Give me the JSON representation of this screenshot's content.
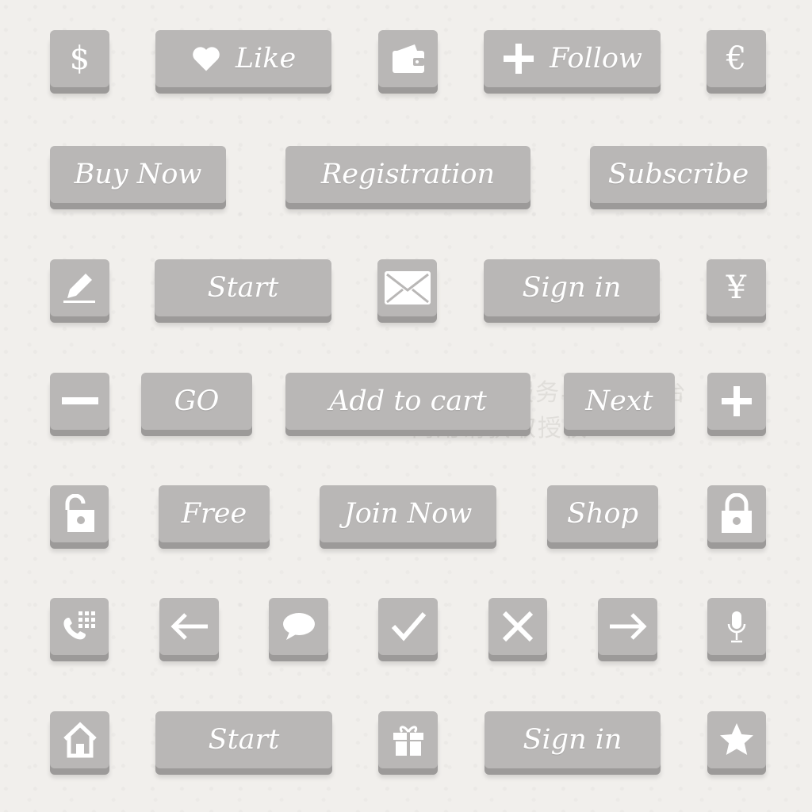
{
  "colors": {
    "background": "#f1efec",
    "button_face": "#b9b7b6",
    "button_edge": "#9c9a99",
    "foreground": "#ffffff"
  },
  "rows": [
    [
      {
        "icon": "dollar-icon",
        "glyph": "$"
      },
      {
        "icon": "heart-icon",
        "label": "Like"
      },
      {
        "icon": "wallet-icon"
      },
      {
        "icon": "plus-icon",
        "label": "Follow"
      },
      {
        "icon": "euro-icon",
        "glyph": "€"
      }
    ],
    [
      {
        "label": "Buy Now"
      },
      {
        "label": "Registration"
      },
      {
        "label": "Subscribe"
      }
    ],
    [
      {
        "icon": "pencil-icon"
      },
      {
        "label": "Start"
      },
      {
        "icon": "mail-icon"
      },
      {
        "label": "Sign in"
      },
      {
        "icon": "yen-icon",
        "glyph": "¥"
      }
    ],
    [
      {
        "icon": "minus-icon"
      },
      {
        "label": "GO"
      },
      {
        "label": "Add to cart"
      },
      {
        "label": "Next"
      },
      {
        "icon": "plus-icon"
      }
    ],
    [
      {
        "icon": "unlock-icon"
      },
      {
        "label": "Free"
      },
      {
        "label": "Join Now"
      },
      {
        "label": "Shop"
      },
      {
        "icon": "lock-icon"
      }
    ],
    [
      {
        "icon": "phone-keypad-icon"
      },
      {
        "icon": "arrow-left-icon"
      },
      {
        "icon": "chat-bubble-icon"
      },
      {
        "icon": "checkmark-icon"
      },
      {
        "icon": "close-icon"
      },
      {
        "icon": "arrow-right-icon"
      },
      {
        "icon": "microphone-icon"
      }
    ],
    [
      {
        "icon": "home-icon"
      },
      {
        "label": "Start"
      },
      {
        "icon": "gift-icon"
      },
      {
        "label": "Sign in"
      },
      {
        "icon": "star-icon"
      }
    ]
  ],
  "watermark": {
    "line1": "营销创意服务与协作平台",
    "line2": "商用请获取授权"
  }
}
